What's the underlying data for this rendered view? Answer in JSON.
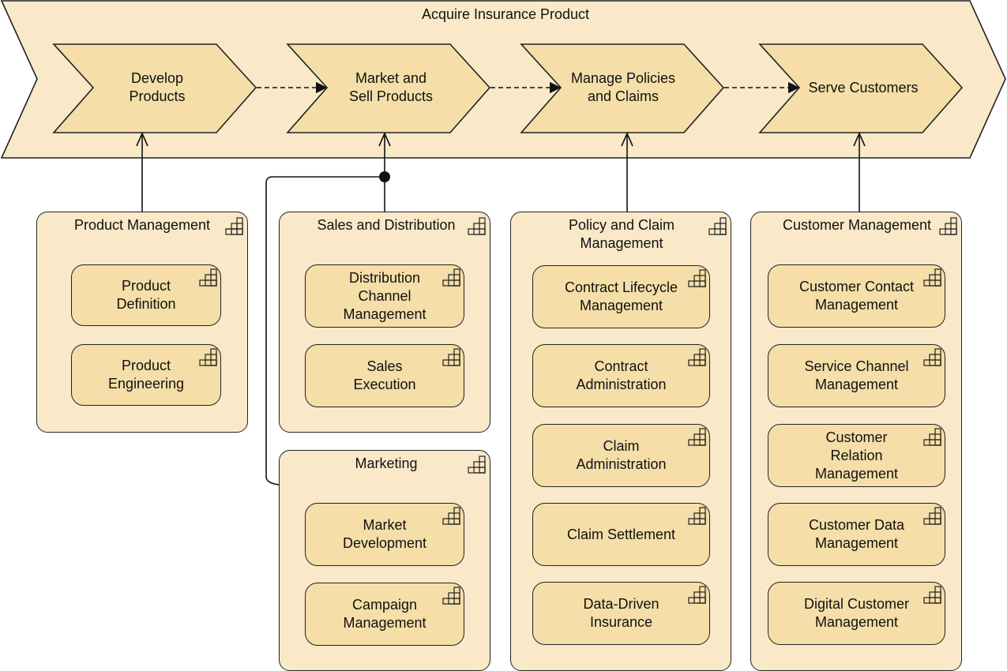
{
  "colors": {
    "value_stream_fill": "#f9e9c9",
    "stage_fill": "#f5dea8",
    "group_fill": "#f9e9c9",
    "capability_fill": "#f5dea8",
    "stroke": "#222222"
  },
  "value_stream": {
    "title": "Acquire Insurance Product",
    "stages": [
      {
        "label": "Develop\nProducts"
      },
      {
        "label": "Market and\nSell Products"
      },
      {
        "label": "Manage Policies\nand Claims"
      },
      {
        "label": "Serve Customers"
      }
    ]
  },
  "groups": [
    {
      "title": "Product Management",
      "capabilities": [
        "Product\nDefinition",
        "Product\nEngineering"
      ]
    },
    {
      "title": "Sales and Distribution",
      "capabilities": [
        "Distribution\nChannel\nManagement",
        "Sales\nExecution"
      ]
    },
    {
      "title": "Marketing",
      "capabilities": [
        "Market\nDevelopment",
        "Campaign\nManagement"
      ]
    },
    {
      "title": "Policy and Claim\nManagement",
      "capabilities": [
        "Contract Lifecycle\nManagement",
        "Contract\nAdministration",
        "Claim\nAdministration",
        "Claim Settlement",
        "Data-Driven\nInsurance"
      ]
    },
    {
      "title": "Customer Management",
      "capabilities": [
        "Customer Contact\nManagement",
        "Service Channel\nManagement",
        "Customer\nRelation\nManagement",
        "Customer Data\nManagement",
        "Digital Customer\nManagement"
      ]
    }
  ],
  "icons": {
    "capability": "capability-icon",
    "flow_arrow": "flow-arrow-icon",
    "serving_arrow": "serving-arrow-icon",
    "junction": "junction-dot"
  }
}
